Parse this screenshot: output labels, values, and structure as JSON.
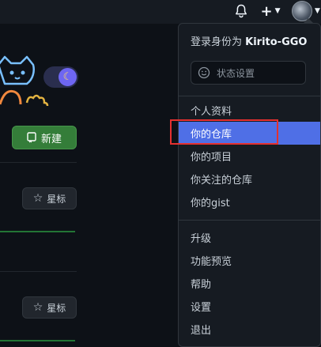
{
  "header": {
    "icons": [
      "bell-icon",
      "plus-icon",
      "avatar"
    ]
  },
  "left": {
    "new_label": "新建",
    "star_label": "星标"
  },
  "menu": {
    "signed_in_prefix": "登录身份为 ",
    "username": "Kirito-GGO",
    "status_placeholder": "状态设置",
    "group1": [
      "个人资料",
      "你的仓库",
      "你的项目",
      "你关注的仓库",
      "你的gist"
    ],
    "group2": [
      "升级",
      "功能预览",
      "帮助",
      "设置",
      "退出"
    ],
    "active_item": "你的仓库"
  },
  "colors": {
    "accent": "#4f6fe6",
    "highlight_box": "#e5302f",
    "new_button": "#347d39"
  }
}
